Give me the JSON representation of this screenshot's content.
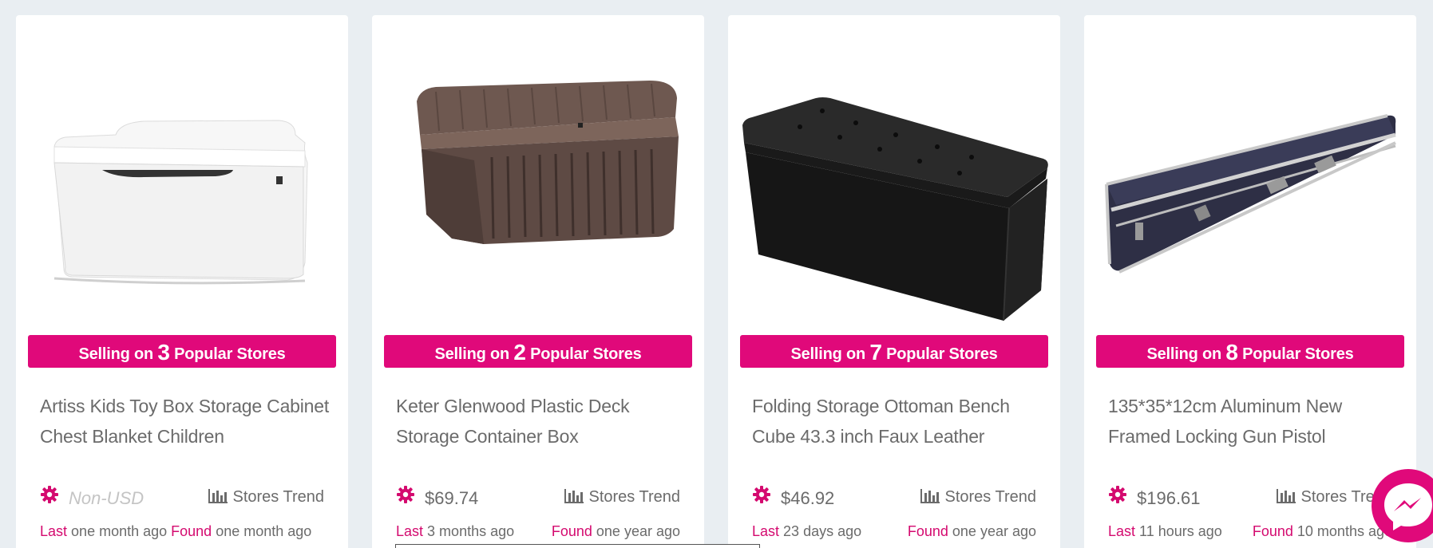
{
  "colors": {
    "accent": "#e0097a",
    "page_bg": "#e9eef2",
    "card_bg": "#ffffff",
    "text": "#6b6b6b",
    "label_pink": "#d40a6f"
  },
  "banner": {
    "prefix": "Selling on",
    "suffix": "Popular Stores"
  },
  "labels": {
    "stores_trend": "Stores Trend",
    "last": "Last",
    "found": "Found"
  },
  "products": [
    {
      "title": "Artiss Kids Toy Box Storage Cabinet Chest Blanket Children",
      "stores": "3",
      "price": "Non-USD",
      "last": "one month ago",
      "found": "one month ago",
      "image_icon": "toy-box-image"
    },
    {
      "title": "Keter Glenwood Plastic Deck Storage Container Box",
      "stores": "2",
      "price": "$69.74",
      "last": "3 months ago",
      "found": "one year ago",
      "image_icon": "deck-box-image"
    },
    {
      "title": "Folding Storage Ottoman Bench Cube 43.3 inch Faux Leather",
      "stores": "7",
      "price": "$46.92",
      "last": "23 days ago",
      "found": "one year ago",
      "image_icon": "ottoman-bench-image"
    },
    {
      "title": "135*35*12cm Aluminum New Framed Locking Gun Pistol",
      "stores": "8",
      "price": "$196.61",
      "last": "11 hours ago",
      "found": "10 months ago",
      "image_icon": "gun-case-image"
    }
  ],
  "chat": {
    "icon": "messenger-icon"
  }
}
